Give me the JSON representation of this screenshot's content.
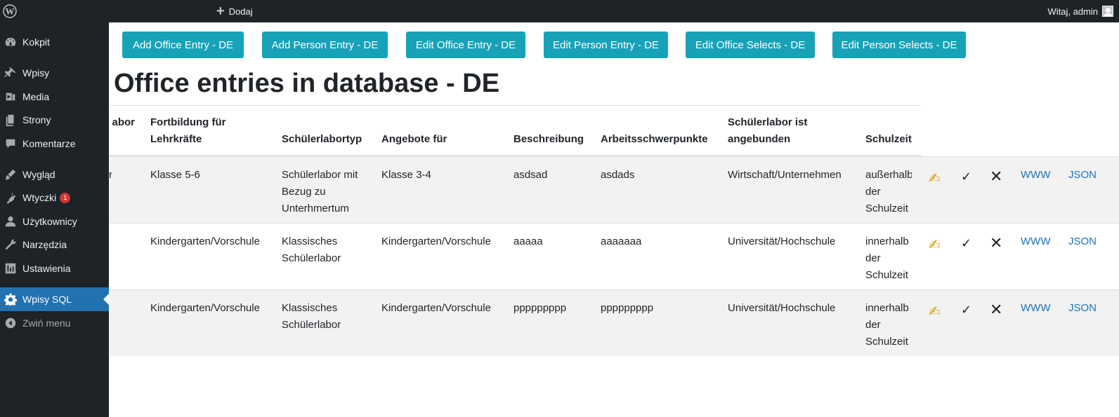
{
  "adminbar": {
    "new_label": "Dodaj",
    "greeting": "Witaj, admin"
  },
  "sidebar": {
    "items": [
      {
        "label": "Kokpit",
        "icon": "dashboard-icon"
      },
      {
        "label": "Wpisy",
        "icon": "pin-icon"
      },
      {
        "label": "Media",
        "icon": "media-icon"
      },
      {
        "label": "Strony",
        "icon": "pages-icon"
      },
      {
        "label": "Komentarze",
        "icon": "comments-icon"
      },
      {
        "label": "Wygląd",
        "icon": "appearance-icon"
      },
      {
        "label": "Wtyczki",
        "icon": "plugins-icon",
        "badge": "1"
      },
      {
        "label": "Użytkownicy",
        "icon": "users-icon"
      },
      {
        "label": "Narzędzia",
        "icon": "tools-icon"
      },
      {
        "label": "Ustawienia",
        "icon": "settings-icon"
      },
      {
        "label": "Wpisy SQL",
        "icon": "gear-icon",
        "active": true
      },
      {
        "label": "Zwiń menu",
        "icon": "collapse-icon"
      }
    ]
  },
  "buttons": [
    "Add Office Entry - DE",
    "Add Person Entry - DE",
    "Edit Office Entry - DE",
    "Edit Person Entry - DE",
    "Edit Office Selects - DE",
    "Edit Person Selects - DE"
  ],
  "page": {
    "title": "Office entries in database - DE"
  },
  "table": {
    "headers": {
      "h0": "abor",
      "h1a": "Fortbildung für",
      "h1b": "Lehrkräfte",
      "h2": "Schülerlabortyp",
      "h3": "Angebote für",
      "h4": "Beschreibung",
      "h5": "Arbeitsschwerpunkte",
      "h6a": "Schülerlabor ist",
      "h6b": "angebunden",
      "h7": "Schulzeit"
    },
    "rows": [
      {
        "c0": "r",
        "fortbildung": "Klasse 5-6",
        "typ_l1": "Schülerlabor mit",
        "typ_l2": "Bezug zu",
        "typ_l3": "Unterhmertum",
        "angebote": "Klasse 3-4",
        "beschreibung": "asdsad",
        "schwerpunkte": "asdads",
        "angebunden": "Wirtschaft/Unternehmen",
        "schulzeit_l1": "außerhalb",
        "schulzeit_l2": "der",
        "schulzeit_l3": "Schulzeit"
      },
      {
        "c0": "",
        "fortbildung": "Kindergarten/Vorschule",
        "typ_l1": "Klassisches",
        "typ_l2": "Schülerlabor",
        "typ_l3": "",
        "angebote": "Kindergarten/Vorschule",
        "beschreibung": "aaaaa",
        "schwerpunkte": "aaaaaaa",
        "angebunden": "Universität/Hochschule",
        "schulzeit_l1": "innerhalb",
        "schulzeit_l2": "der",
        "schulzeit_l3": "Schulzeit"
      },
      {
        "c0": "",
        "fortbildung": "Kindergarten/Vorschule",
        "typ_l1": "Klassisches",
        "typ_l2": "Schülerlabor",
        "typ_l3": "",
        "angebote": "Kindergarten/Vorschule",
        "beschreibung": "ppppppppp",
        "schwerpunkte": "ppppppppp",
        "angebunden": "Universität/Hochschule",
        "schulzeit_l1": "innerhalb",
        "schulzeit_l2": "der",
        "schulzeit_l3": "Schulzeit"
      }
    ],
    "actions": {
      "edit": "✍",
      "check": "✓",
      "delete": "✕",
      "www": "WWW",
      "json": "JSON"
    }
  }
}
